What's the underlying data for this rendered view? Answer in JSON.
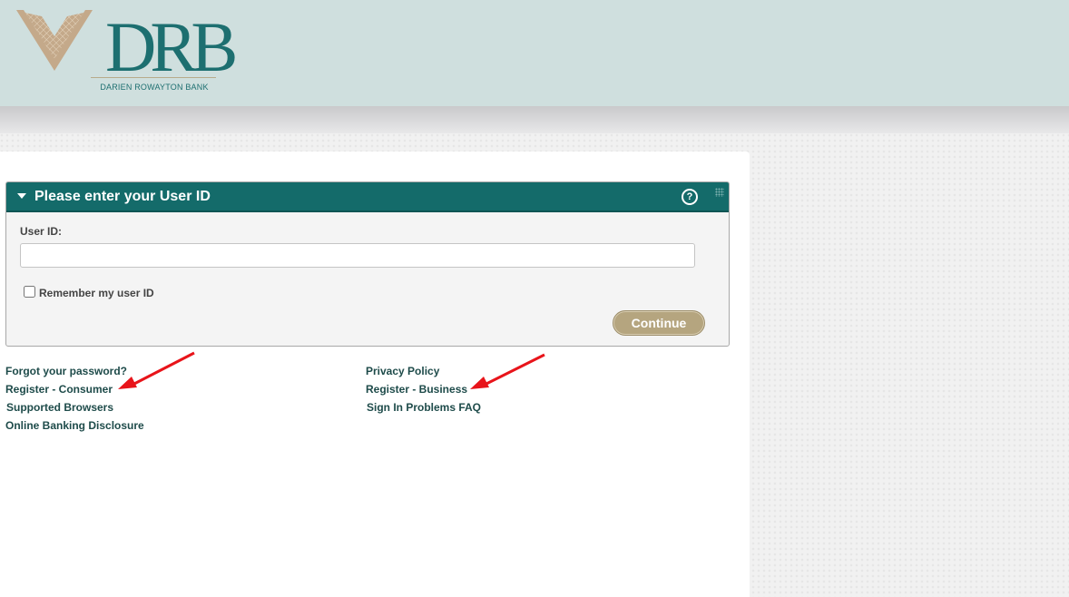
{
  "header": {
    "logo_text": "DRB",
    "logo_tagline": "DARIEN ROWAYTON BANK"
  },
  "panel": {
    "title": "Please enter your User ID",
    "help_glyph": "?",
    "collapse_icon": "triangle-down-icon",
    "help_icon": "help-circle-icon",
    "userid_label": "User ID:",
    "userid_value": "",
    "remember_label": "Remember my user ID",
    "remember_checked": false,
    "continue_label": "Continue"
  },
  "links": {
    "left": [
      "Forgot your password?",
      "Register - Consumer",
      "Supported Browsers",
      "Online Banking Disclosure"
    ],
    "right": [
      "Privacy Policy",
      "Register - Business",
      "Sign In Problems FAQ"
    ]
  },
  "colors": {
    "header_bg": "#cfdfde",
    "brand_teal": "#146b6a",
    "button_tan": "#b5a57f",
    "link_text": "#1e4b4a",
    "annotation_arrow": "#e8141a"
  }
}
